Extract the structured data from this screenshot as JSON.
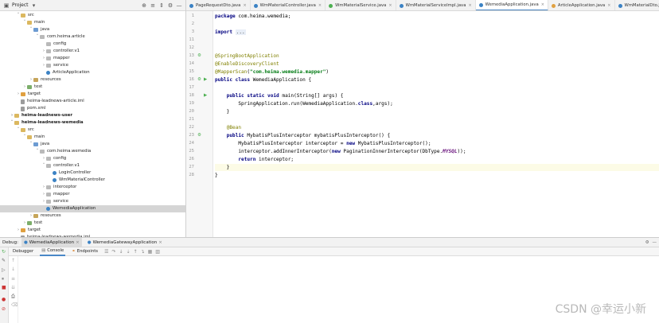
{
  "project_panel": {
    "title": "Project",
    "tree": [
      {
        "label": "src",
        "indent": 2,
        "icon": "folder",
        "arrow": "open"
      },
      {
        "label": "main",
        "indent": 3,
        "icon": "folder",
        "arrow": "open"
      },
      {
        "label": "java",
        "indent": 4,
        "icon": "src",
        "arrow": "open"
      },
      {
        "label": "com.heima.article",
        "indent": 5,
        "icon": "pkg",
        "arrow": "open"
      },
      {
        "label": "config",
        "indent": 6,
        "icon": "pkg",
        "arrow": "none"
      },
      {
        "label": "controller.v1",
        "indent": 6,
        "icon": "pkg",
        "arrow": "closed"
      },
      {
        "label": "mapper",
        "indent": 6,
        "icon": "pkg",
        "arrow": "closed"
      },
      {
        "label": "service",
        "indent": 6,
        "icon": "pkg",
        "arrow": "closed"
      },
      {
        "label": "ArticleApplication",
        "indent": 6,
        "icon": "cls",
        "arrow": "none"
      },
      {
        "label": "resources",
        "indent": 4,
        "icon": "res",
        "arrow": "closed"
      },
      {
        "label": "test",
        "indent": 3,
        "icon": "test",
        "arrow": "closed"
      },
      {
        "label": "target",
        "indent": 2,
        "icon": "target",
        "arrow": "closed"
      },
      {
        "label": "heima-leadnews-article.iml",
        "indent": 2,
        "icon": "file",
        "arrow": "none"
      },
      {
        "label": "pom.xml",
        "indent": 2,
        "icon": "file",
        "arrow": "none"
      },
      {
        "label": "heima-leadnews-user",
        "indent": 1,
        "icon": "folder",
        "arrow": "closed",
        "bold": true
      },
      {
        "label": "heima-leadnews-wemedia",
        "indent": 1,
        "icon": "folder",
        "arrow": "open",
        "bold": true
      },
      {
        "label": "src",
        "indent": 2,
        "icon": "folder",
        "arrow": "open"
      },
      {
        "label": "main",
        "indent": 3,
        "icon": "folder",
        "arrow": "open"
      },
      {
        "label": "java",
        "indent": 4,
        "icon": "src",
        "arrow": "open"
      },
      {
        "label": "com.heima.wemedia",
        "indent": 5,
        "icon": "pkg",
        "arrow": "open"
      },
      {
        "label": "config",
        "indent": 6,
        "icon": "pkg",
        "arrow": "closed"
      },
      {
        "label": "controller.v1",
        "indent": 6,
        "icon": "pkg",
        "arrow": "open"
      },
      {
        "label": "LoginController",
        "indent": 7,
        "icon": "cls",
        "arrow": "none"
      },
      {
        "label": "WmMaterialController",
        "indent": 7,
        "icon": "cls",
        "arrow": "none"
      },
      {
        "label": "interceptor",
        "indent": 6,
        "icon": "pkg",
        "arrow": "closed"
      },
      {
        "label": "mapper",
        "indent": 6,
        "icon": "pkg",
        "arrow": "closed"
      },
      {
        "label": "service",
        "indent": 6,
        "icon": "pkg",
        "arrow": "closed"
      },
      {
        "label": "WemediaApplication",
        "indent": 6,
        "icon": "cls",
        "arrow": "none",
        "selected": true
      },
      {
        "label": "resources",
        "indent": 4,
        "icon": "res",
        "arrow": "closed"
      },
      {
        "label": "test",
        "indent": 3,
        "icon": "test",
        "arrow": "closed"
      },
      {
        "label": "target",
        "indent": 2,
        "icon": "target",
        "arrow": "closed"
      },
      {
        "label": "heima-leadnews-wemedia.iml",
        "indent": 2,
        "icon": "file",
        "arrow": "none"
      }
    ]
  },
  "editor_tabs": [
    {
      "label": "PageRequestDto.java",
      "color": "#3b82c4"
    },
    {
      "label": "WmMaterialController.java",
      "color": "#3b82c4"
    },
    {
      "label": "WmMaterialService.java",
      "color": "#4caf50"
    },
    {
      "label": "WmMaterialServiceImpl.java",
      "color": "#3b82c4"
    },
    {
      "label": "WemediaApplication.java",
      "color": "#3b82c4",
      "active": true
    },
    {
      "label": "ArticleApplication.java",
      "color": "#e0a040"
    },
    {
      "label": "WmMaterialDto.java",
      "color": "#3b82c4"
    }
  ],
  "code_lines": [
    {
      "n": "1",
      "html": "<span class=\"kw\">package</span> com.heima.wemedia;"
    },
    {
      "n": "2",
      "html": ""
    },
    {
      "n": "3",
      "html": "<span class=\"kw\">import</span> <span class=\"fold\">...</span>"
    },
    {
      "n": "11",
      "html": ""
    },
    {
      "n": "12",
      "html": ""
    },
    {
      "n": "13",
      "html": "<span class=\"an\">@SpringBootApplication</span>"
    },
    {
      "n": "14",
      "html": "<span class=\"an\">@EnableDiscoveryClient</span>"
    },
    {
      "n": "15",
      "html": "<span class=\"an\">@MapperScan</span>(<span class=\"str\">\"com.heima.wemedia.mapper\"</span>)"
    },
    {
      "n": "16",
      "html": "<span class=\"kw\">public class</span> WemediaApplication {"
    },
    {
      "n": "17",
      "html": ""
    },
    {
      "n": "18",
      "html": "    <span class=\"kw\">public static void</span> main(String[] args) {"
    },
    {
      "n": "19",
      "html": "        SpringApplication.<span class=\"it\">run</span>(WemediaApplication.<span class=\"kw\">class</span>,args);"
    },
    {
      "n": "20",
      "html": "    }"
    },
    {
      "n": "21",
      "html": ""
    },
    {
      "n": "22",
      "html": "    <span class=\"an\">@Bean</span>"
    },
    {
      "n": "23",
      "html": "    <span class=\"kw\">public</span> MybatisPlusInterceptor mybatisPlusInterceptor() {"
    },
    {
      "n": "24",
      "html": "        MybatisPlusInterceptor interceptor = <span class=\"kw\">new</span> MybatisPlusInterceptor();"
    },
    {
      "n": "25",
      "html": "        interceptor.addInnerInterceptor(<span class=\"kw\">new</span> PaginationInnerInterceptor(DbType.<span class=\"fld\">MYSQL</span>));"
    },
    {
      "n": "26",
      "html": "        <span class=\"kw\">return</span> interceptor;"
    },
    {
      "n": "27",
      "html": "    }",
      "current": true
    },
    {
      "n": "28",
      "html": "}"
    }
  ],
  "debug_bar": {
    "label": "Debug:",
    "tabs": [
      {
        "label": "WemediaApplication",
        "active": true
      },
      {
        "label": "WemediaGatewayApplication",
        "active": false
      }
    ]
  },
  "debug_subtabs": [
    {
      "label": "Debugger",
      "active": false
    },
    {
      "label": "Console",
      "active": true
    },
    {
      "label": "Endpoints",
      "active": false
    }
  ],
  "watermark": "CSDN @幸运小新"
}
